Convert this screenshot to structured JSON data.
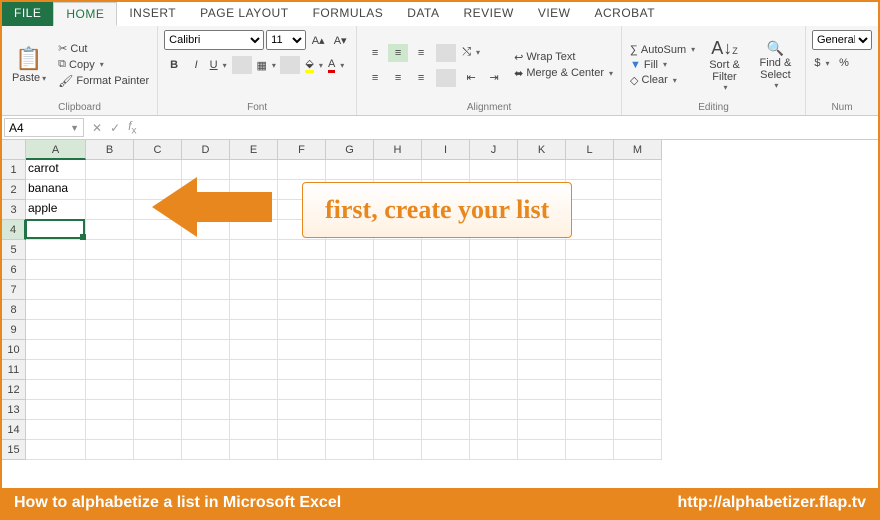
{
  "tabs": [
    "FILE",
    "HOME",
    "INSERT",
    "PAGE LAYOUT",
    "FORMULAS",
    "DATA",
    "REVIEW",
    "VIEW",
    "ACROBAT"
  ],
  "active_tab": "HOME",
  "ribbon": {
    "clipboard": {
      "label": "Clipboard",
      "paste": "Paste",
      "cut": "Cut",
      "copy": "Copy",
      "painter": "Format Painter"
    },
    "font": {
      "label": "Font",
      "name": "Calibri",
      "size": "11"
    },
    "alignment": {
      "label": "Alignment",
      "wrap": "Wrap Text",
      "merge": "Merge & Center"
    },
    "editing": {
      "label": "Editing",
      "autosum": "AutoSum",
      "fill": "Fill",
      "clear": "Clear",
      "sort": "Sort & Filter",
      "find": "Find & Select"
    },
    "number": {
      "label": "Num",
      "format": "General"
    }
  },
  "name_box": "A4",
  "columns": [
    "A",
    "B",
    "C",
    "D",
    "E",
    "F",
    "G",
    "H",
    "I",
    "J",
    "K",
    "L",
    "M"
  ],
  "rows": 15,
  "selected_col": "A",
  "selected_row": 4,
  "cells": {
    "A1": "carrot",
    "A2": "banana",
    "A3": "apple"
  },
  "callout_text": "first, create your list",
  "footer_left": "How to alphabetize a list in Microsoft Excel",
  "footer_right": "http://alphabetizer.flap.tv",
  "colors": {
    "accent": "#217346",
    "orange": "#e8871e"
  }
}
